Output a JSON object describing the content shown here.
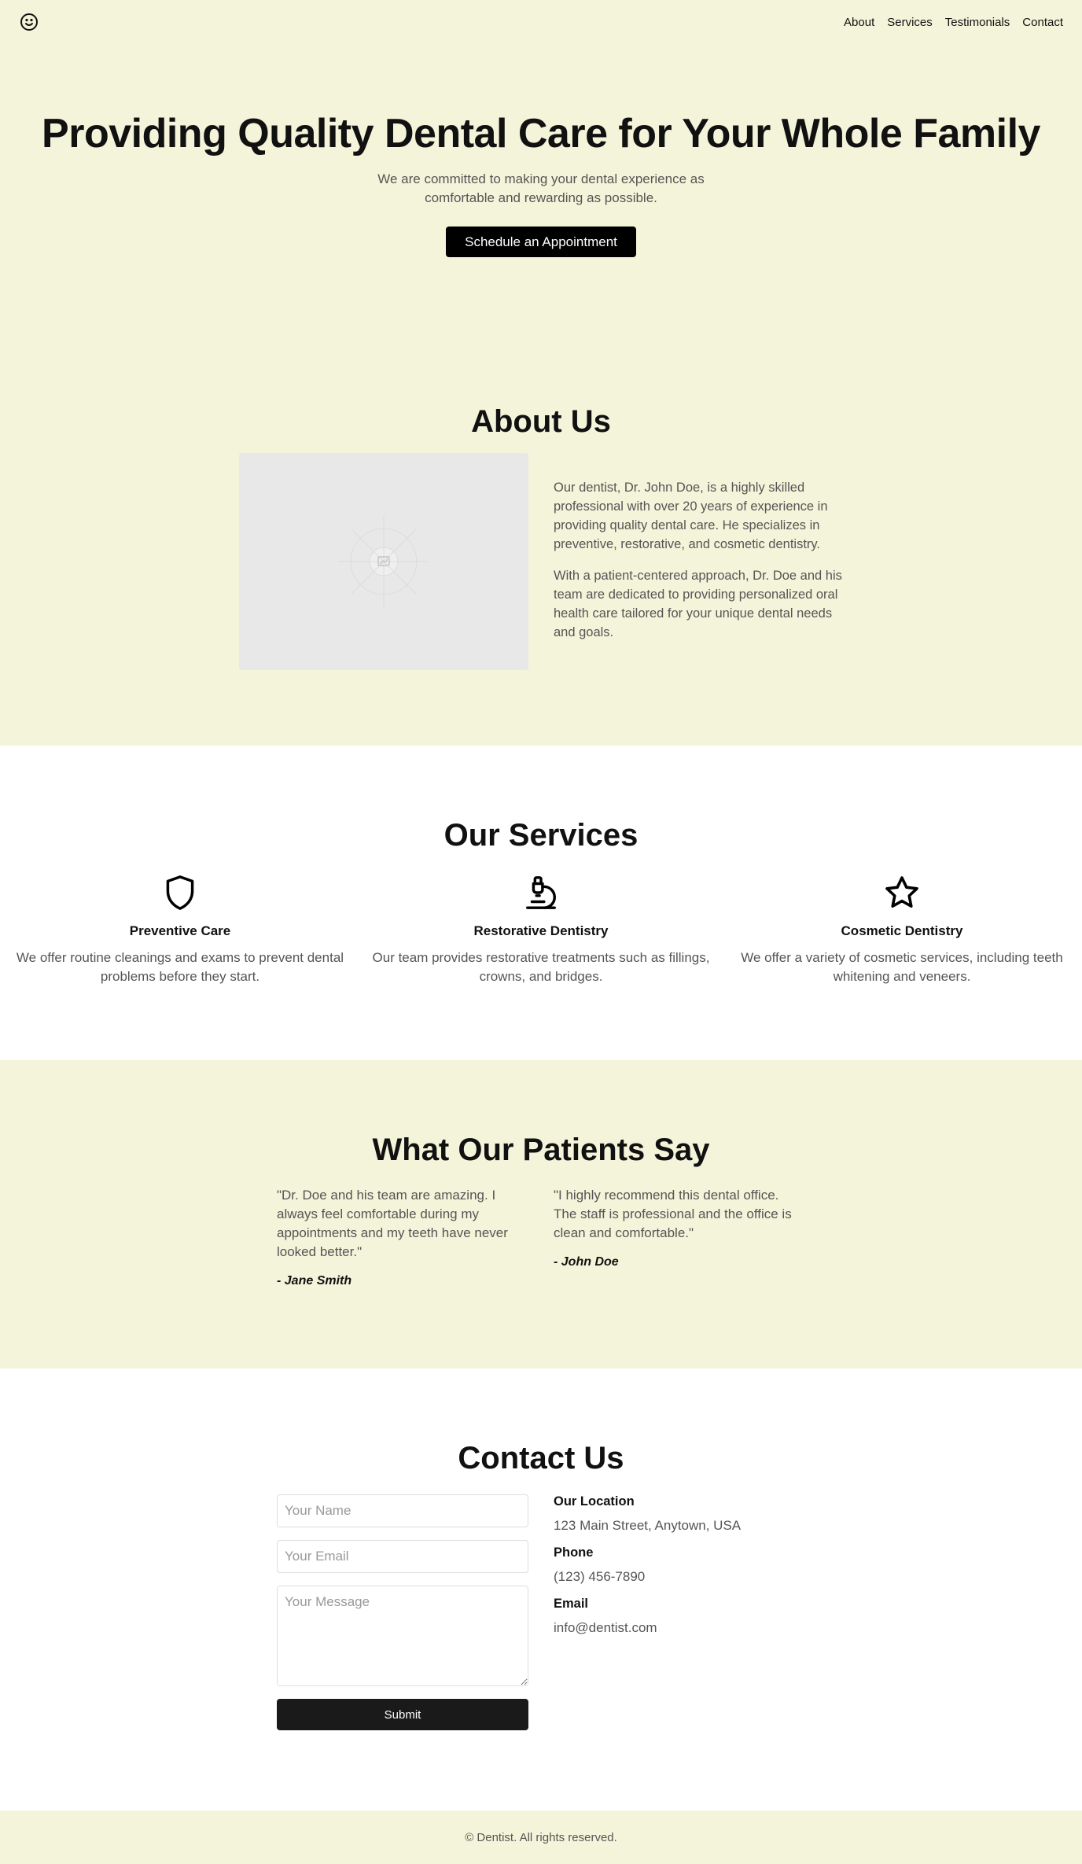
{
  "header": {
    "logo_icon": "smiley-face-icon",
    "nav": [
      {
        "label": "About"
      },
      {
        "label": "Services"
      },
      {
        "label": "Testimonials"
      },
      {
        "label": "Contact"
      }
    ]
  },
  "hero": {
    "title": "Providing Quality Dental Care for Your Whole Family",
    "subtitle": "We are committed to making your dental experience as comfortable and rewarding as possible.",
    "cta_label": "Schedule an Appointment"
  },
  "about": {
    "title": "About Us",
    "image_icon": "image-placeholder-icon",
    "paragraphs": [
      "Our dentist, Dr. John Doe, is a highly skilled professional with over 20 years of experience in providing quality dental care. He specializes in preventive, restorative, and cosmetic dentistry.",
      "With a patient-centered approach, Dr. Doe and his team are dedicated to providing personalized oral health care tailored for your unique dental needs and goals."
    ]
  },
  "services": {
    "title": "Our Services",
    "items": [
      {
        "icon": "shield-icon",
        "title": "Preventive Care",
        "text": "We offer routine cleanings and exams to prevent dental problems before they start."
      },
      {
        "icon": "microscope-icon",
        "title": "Restorative Dentistry",
        "text": "Our team provides restorative treatments such as fillings, crowns, and bridges."
      },
      {
        "icon": "star-icon",
        "title": "Cosmetic Dentistry",
        "text": "We offer a variety of cosmetic services, including teeth whitening and veneers."
      }
    ]
  },
  "testimonials": {
    "title": "What Our Patients Say",
    "items": [
      {
        "quote": "\"Dr. Doe and his team are amazing. I always feel comfortable during my appointments and my teeth have never looked better.\"",
        "author": "- Jane Smith"
      },
      {
        "quote": "\"I highly recommend this dental office. The staff is professional and the office is clean and comfortable.\"",
        "author": "- John Doe"
      }
    ]
  },
  "contact": {
    "title": "Contact Us",
    "form": {
      "name_placeholder": "Your Name",
      "email_placeholder": "Your Email",
      "message_placeholder": "Your Message",
      "submit_label": "Submit"
    },
    "info": [
      {
        "label": "Our Location",
        "value": "123 Main Street, Anytown, USA"
      },
      {
        "label": "Phone",
        "value": "(123) 456-7890"
      },
      {
        "label": "Email",
        "value": "info@dentist.com"
      }
    ]
  },
  "footer": {
    "text": "© Dentist. All rights reserved."
  },
  "colors": {
    "section_bg": "#f4f4da",
    "text_primary": "#111111",
    "text_muted": "#555555",
    "button_bg": "#000000"
  }
}
